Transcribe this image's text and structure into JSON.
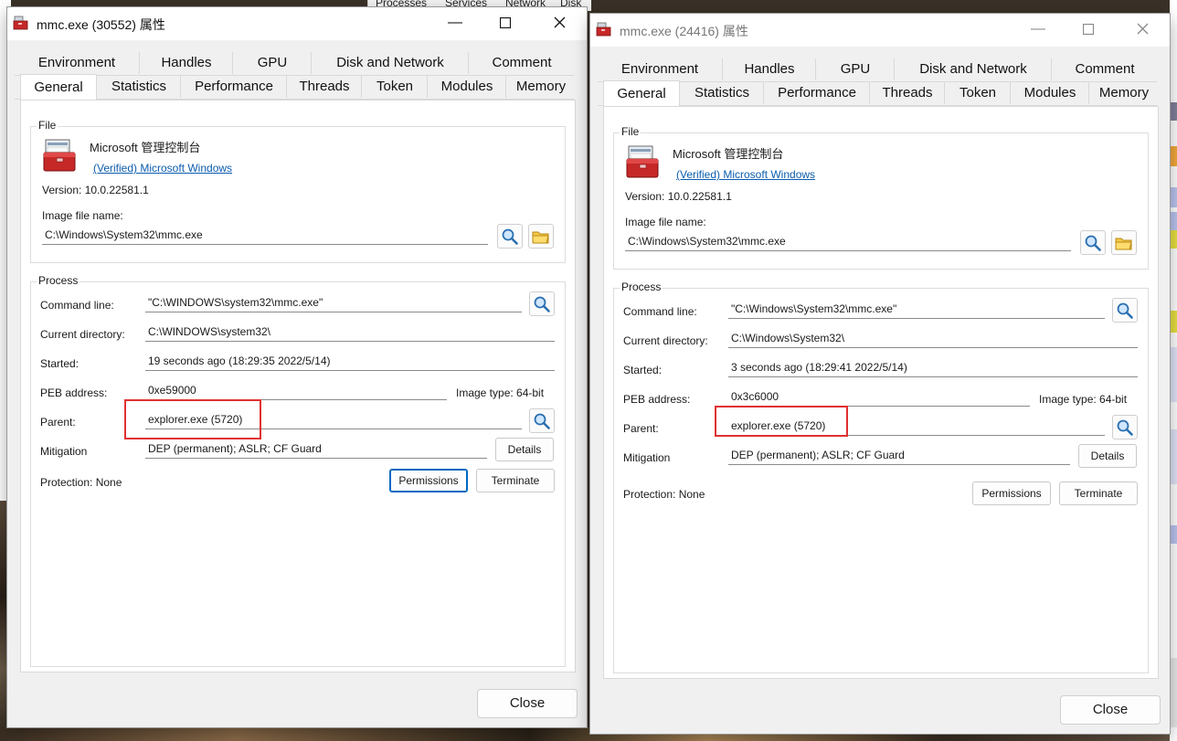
{
  "background": {
    "top_tabs": [
      "Processes",
      "Services",
      "Network",
      "Disk"
    ]
  },
  "dialog_left": {
    "title": "mmc.exe (30552) 属性",
    "tabs_back": [
      "Environment",
      "Handles",
      "GPU",
      "Disk and Network",
      "Comment"
    ],
    "tabs_front": [
      "General",
      "Statistics",
      "Performance",
      "Threads",
      "Token",
      "Modules",
      "Memory"
    ],
    "selected_tab": "General",
    "file": {
      "group_label": "File",
      "description": "Microsoft 管理控制台",
      "verified": "(Verified) Microsoft Windows",
      "version": "Version: 10.0.22581.1",
      "image_label": "Image file name:",
      "image_path": "C:\\Windows\\System32\\mmc.exe"
    },
    "process": {
      "group_label": "Process",
      "command_line_label": "Command line:",
      "command_line": "\"C:\\WINDOWS\\system32\\mmc.exe\"",
      "current_dir_label": "Current directory:",
      "current_dir": "C:\\WINDOWS\\system32\\",
      "started_label": "Started:",
      "started": "19 seconds ago (18:29:35 2022/5/14)",
      "peb_label": "PEB address:",
      "peb": "0xe59000",
      "image_type": "Image type: 64-bit",
      "parent_label": "Parent:",
      "parent": "explorer.exe (5720)",
      "mitigation_label": "Mitigation",
      "mitigation": "DEP (permanent); ASLR; CF Guard",
      "details": "Details",
      "protection": "Protection: None",
      "permissions": "Permissions",
      "terminate": "Terminate"
    },
    "close": "Close"
  },
  "dialog_right": {
    "title": "mmc.exe (24416) 属性",
    "tabs_back": [
      "Environment",
      "Handles",
      "GPU",
      "Disk and Network",
      "Comment"
    ],
    "tabs_front": [
      "General",
      "Statistics",
      "Performance",
      "Threads",
      "Token",
      "Modules",
      "Memory"
    ],
    "selected_tab": "General",
    "file": {
      "group_label": "File",
      "description": "Microsoft 管理控制台",
      "verified": "(Verified) Microsoft Windows",
      "version": "Version: 10.0.22581.1",
      "image_label": "Image file name:",
      "image_path": "C:\\Windows\\System32\\mmc.exe"
    },
    "process": {
      "group_label": "Process",
      "command_line_label": "Command line:",
      "command_line": "\"C:\\Windows\\System32\\mmc.exe\"",
      "current_dir_label": "Current directory:",
      "current_dir": "C:\\Windows\\System32\\",
      "started_label": "Started:",
      "started": "3 seconds ago (18:29:41 2022/5/14)",
      "peb_label": "PEB address:",
      "peb": "0x3c6000",
      "image_type": "Image type: 64-bit",
      "parent_label": "Parent:",
      "parent": "explorer.exe (5720)",
      "mitigation_label": "Mitigation",
      "mitigation": "DEP (permanent); ASLR; CF Guard",
      "details": "Details",
      "protection": "Protection: None",
      "permissions": "Permissions",
      "terminate": "Terminate"
    },
    "close": "Close"
  },
  "icons": {
    "app": "toolbox-icon",
    "search": "magnifier-icon",
    "folder": "folder-icon",
    "minimize": "minimize-icon",
    "maximize": "maximize-icon",
    "close": "close-icon"
  },
  "colors": {
    "highlight": "#e03030",
    "link": "#0b5cad",
    "focus": "#0067c0"
  }
}
